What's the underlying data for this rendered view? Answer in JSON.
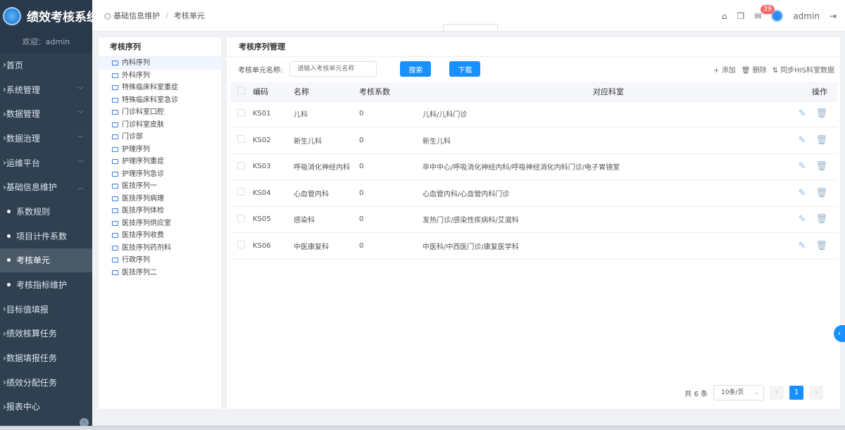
{
  "sidebar": {
    "app_title": "绩效考核系统",
    "welcome": "欢迎：admin",
    "items": [
      {
        "label": "首页",
        "chevron": ""
      },
      {
        "label": "系统管理",
        "chevron": "﹀"
      },
      {
        "label": "数据管理",
        "chevron": "﹀"
      },
      {
        "label": "数据治理",
        "chevron": "﹀"
      },
      {
        "label": "运维平台",
        "chevron": "﹀"
      },
      {
        "label": "基础信息维护",
        "chevron": "︿"
      }
    ],
    "sub_items": [
      {
        "label": "系数规则"
      },
      {
        "label": "项目计件系数"
      },
      {
        "label": "考核单元"
      },
      {
        "label": "考核指标维护"
      }
    ],
    "items_after": [
      {
        "label": "目标值填报"
      },
      {
        "label": "绩效核算任务"
      },
      {
        "label": "数据填报任务"
      },
      {
        "label": "绩效分配任务"
      },
      {
        "label": "报表中心"
      }
    ]
  },
  "breadcrumb": {
    "parent": "基础信息维护",
    "current": "考核单元"
  },
  "topbar": {
    "badge_count": "39",
    "user": "admin"
  },
  "tree": {
    "title": "考核序列",
    "items": [
      "内科序列",
      "外科序列",
      "特殊临床科室重症",
      "特殊临床科室急诊",
      "门诊科室口腔",
      "门诊科室皮肤",
      "门诊部",
      "护理序列",
      "护理序列重症",
      "护理序列急诊",
      "医技序列一",
      "医技序列病理",
      "医技序列体检",
      "医技序列供应室",
      "医技序列收费",
      "医技序列药剂科",
      "行政序列",
      "医技序列二"
    ]
  },
  "main": {
    "title": "考核序列管理",
    "search_label": "考核单元名称:",
    "search_placeholder": "请输入考核单元名称",
    "search_button": "搜索",
    "download_button": "下载",
    "add_label": "+ 添加",
    "delete_label": "删除",
    "sync_label": "同步HIS科室数据"
  },
  "table": {
    "headers": {
      "code": "编码",
      "name": "名称",
      "coef": "考核系数",
      "dept": "对应科室",
      "ops": "操作"
    },
    "rows": [
      {
        "code": "KS01",
        "name": "儿科",
        "coef": "0",
        "dept": "儿科/儿科门诊"
      },
      {
        "code": "KS02",
        "name": "新生儿科",
        "coef": "0",
        "dept": "新生儿科"
      },
      {
        "code": "KS03",
        "name": "呼吸消化神经内科",
        "coef": "0",
        "dept": "卒中中心/呼吸消化神经内科/呼吸神经消化内科门诊/电子胃镜室"
      },
      {
        "code": "KS04",
        "name": "心血管内科",
        "coef": "0",
        "dept": "心血管内科/心血管内科门诊"
      },
      {
        "code": "KS05",
        "name": "感染科",
        "coef": "0",
        "dept": "发热门诊/感染性疾病科/艾滋科"
      },
      {
        "code": "KS06",
        "name": "中医康复科",
        "coef": "0",
        "dept": "中医科/中西医门诊/康复医学科"
      }
    ]
  },
  "pager": {
    "total": "共 6 条",
    "page_size": "10条/页",
    "current": "1",
    "prev": "‹",
    "next": "›"
  },
  "colors": {
    "sidebar_bg": "#2f4050",
    "accent": "#1890ff",
    "badge": "#f56c6c"
  }
}
